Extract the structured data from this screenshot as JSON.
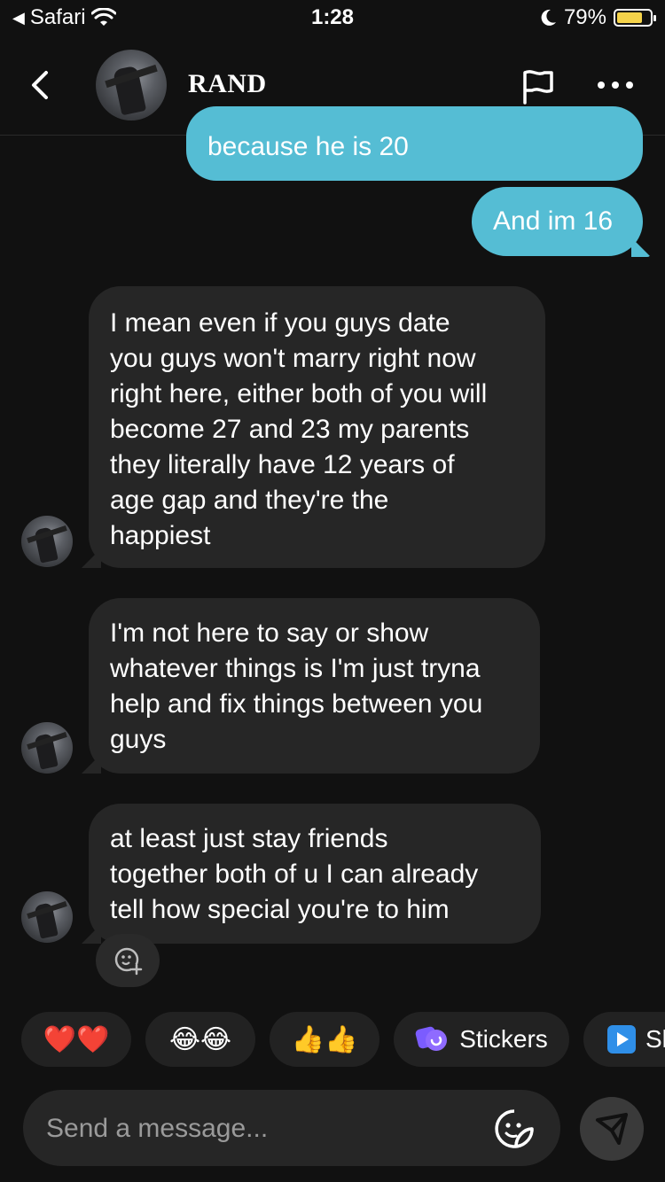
{
  "status_bar": {
    "back_app": "Safari",
    "time": "1:28",
    "battery_percent": "79%",
    "battery_level": 0.79
  },
  "header": {
    "contact_name": "RAND"
  },
  "messages": [
    {
      "direction": "out",
      "text": "because he is 20"
    },
    {
      "direction": "out",
      "text": "And im 16"
    },
    {
      "direction": "in",
      "lines": [
        "I mean even if you guys date",
        "you guys won't marry right now",
        "right here, either both of you will",
        "become 27 and 23 my parents",
        "they literally have 12 years of",
        "age gap and they're the",
        "happiest"
      ]
    },
    {
      "direction": "in",
      "lines": [
        "I'm not here to say or show",
        "whatever things is I'm just tryna",
        "help and fix things between you",
        "guys"
      ]
    },
    {
      "direction": "in",
      "lines": [
        "at least just stay friends",
        "together both of u I can already",
        "tell how special you're to him"
      ]
    }
  ],
  "quick_reactions": [
    {
      "emoji": "❤️❤️"
    },
    {
      "emoji": "😂😂"
    },
    {
      "emoji": "👍👍"
    },
    {
      "icon": "stickers-icon",
      "label": "Stickers",
      "color": "#7b5cff"
    },
    {
      "icon": "video-icon",
      "label": "Sl",
      "color": "#2f8fe8"
    }
  ],
  "composer": {
    "placeholder": "Send a message..."
  },
  "colors": {
    "background": "#111111",
    "outgoing_bubble": "#55bdd4",
    "incoming_bubble": "#262626",
    "battery_fill": "#f5d34a"
  }
}
